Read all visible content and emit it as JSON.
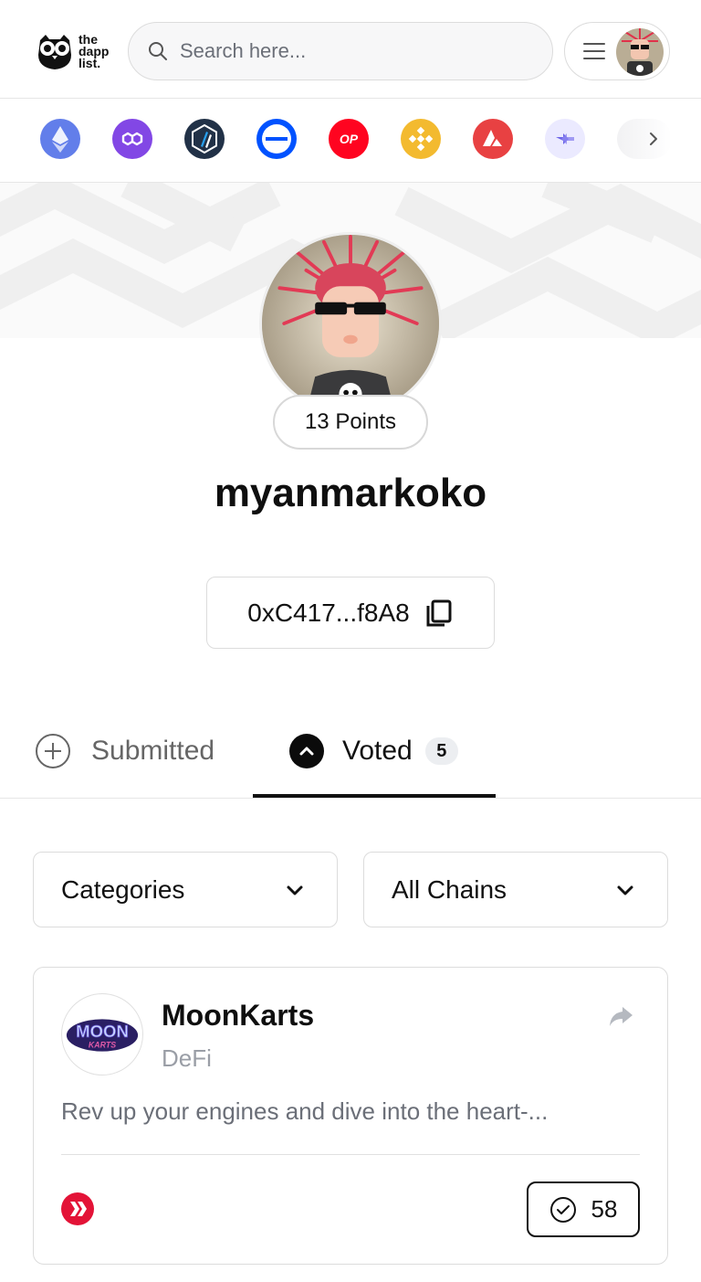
{
  "header": {
    "logo_lines": [
      "the",
      "dapp",
      "list."
    ],
    "search_placeholder": "Search here..."
  },
  "chains": [
    {
      "name": "ethereum",
      "color": "#627eea"
    },
    {
      "name": "polygon",
      "color": "#8247e5"
    },
    {
      "name": "arbitrum",
      "color": "#213147"
    },
    {
      "name": "base",
      "color": "#0052ff"
    },
    {
      "name": "optimism",
      "color": "#ff0420",
      "label": "OP"
    },
    {
      "name": "bnb",
      "color": "#f3ba2f"
    },
    {
      "name": "avalanche",
      "color": "#e84142"
    },
    {
      "name": "bridge",
      "color": "#ebeaff"
    }
  ],
  "profile": {
    "points": "13 Points",
    "username": "myanmarkoko",
    "address": "0xC417...f8A8"
  },
  "tabs": {
    "submitted_label": "Submitted",
    "voted_label": "Voted",
    "voted_count": "5"
  },
  "filters": {
    "categories_label": "Categories",
    "chains_label": "All Chains"
  },
  "card": {
    "title": "MoonKarts",
    "category": "DeFi",
    "description": "Rev up your engines and dive into the heart-...",
    "logo_text_top": "MOON",
    "logo_text_bottom": "KARTS",
    "votes": "58",
    "chain_color": "#e31337"
  }
}
